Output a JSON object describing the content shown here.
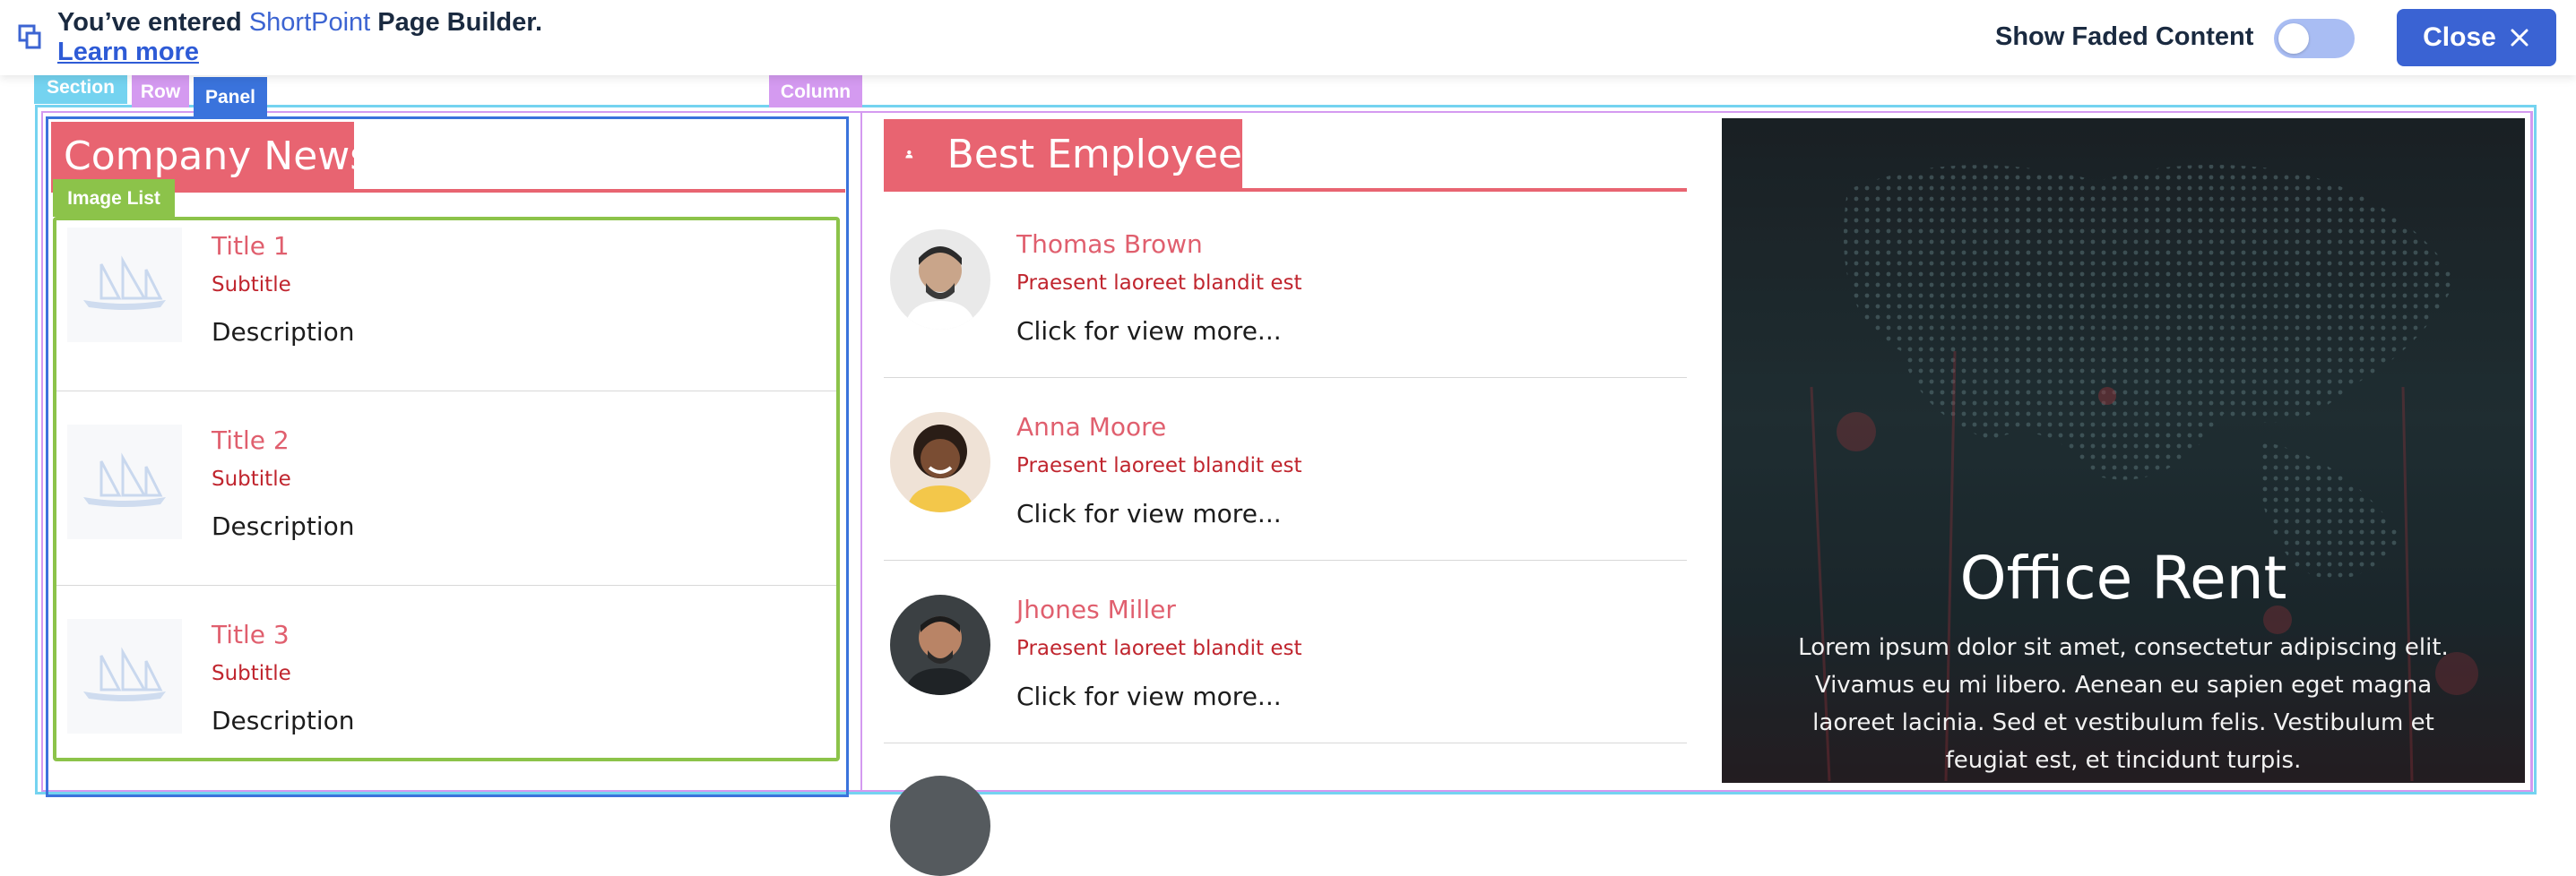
{
  "topbar": {
    "intro_before": "You’ve entered ",
    "brand": "ShortPoint",
    "intro_after": " Page Builder.",
    "learn_more": "Learn more",
    "faded_label": "Show Faded Content",
    "faded_on": false,
    "close_label": "Close"
  },
  "tags": {
    "section": "Section",
    "row": "Row",
    "panel": "Panel",
    "column": "Column",
    "image_list": "Image List"
  },
  "colors": {
    "section_frame": "#74d3f0",
    "row_frame": "#d49af0",
    "panel_frame": "#3a73dc",
    "image_list_frame": "#8cc34a",
    "accent_red": "#e86471"
  },
  "company_news": {
    "title": "Company News",
    "items": [
      {
        "title": "Title 1",
        "subtitle": "Subtitle",
        "description": "Description",
        "icon": "ship-placeholder-icon"
      },
      {
        "title": "Title 2",
        "subtitle": "Subtitle",
        "description": "Description",
        "icon": "ship-placeholder-icon"
      },
      {
        "title": "Title 3",
        "subtitle": "Subtitle",
        "description": "Description",
        "icon": "ship-placeholder-icon"
      }
    ]
  },
  "best_employee": {
    "title": "Best Employee",
    "header_icon": "person-icon",
    "items": [
      {
        "name": "Thomas Brown",
        "subtitle": "Praesent laoreet blandit est",
        "link": "Click for view more..."
      },
      {
        "name": "Anna Moore",
        "subtitle": "Praesent laoreet blandit est",
        "link": "Click for view more..."
      },
      {
        "name": "Jhones Miller",
        "subtitle": "Praesent laoreet blandit est",
        "link": "Click for view more..."
      }
    ]
  },
  "office_rent": {
    "title": "Office Rent",
    "body": "Lorem ipsum dolor sit amet, consectetur adipiscing elit. Vivamus eu mi libero. Aenean eu sapien eget magna laoreet lacinia. Sed et vestibulum felis. Vestibulum et feugiat est, et tincidunt turpis."
  }
}
